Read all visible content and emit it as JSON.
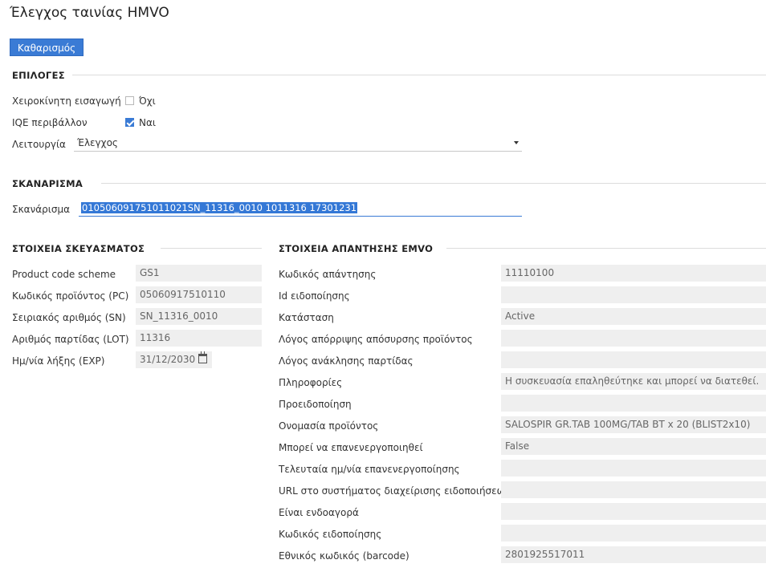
{
  "page": {
    "title": "Έλεγχος ταινίας ΗΜVO"
  },
  "toolbar": {
    "clear_label": "Καθαρισμός"
  },
  "options": {
    "heading": "ΕΠΙΛΟΓΕΣ",
    "manual_entry": {
      "label": "Χειροκίνητη εισαγωγή",
      "checked": false,
      "value": "Όχι"
    },
    "iqe_env": {
      "label": "IQE περιβάλλον",
      "checked": true,
      "value": "Ναι"
    },
    "function": {
      "label": "Λειτουργία",
      "value": "Έλεγχος"
    }
  },
  "scan": {
    "heading": "ΣΚΑΝΑΡΙΣΜΑ",
    "label": "Σκανάρισμα",
    "value": "010506091751011021SN_11316_0010 1011316 17301231"
  },
  "package": {
    "heading": "ΣΤΟΙΧΕΙΑ ΣΚΕΥΑΣΜΑΤΟΣ",
    "fields": [
      {
        "label": "Product code scheme",
        "value": "GS1"
      },
      {
        "label": "Κωδικός προϊόντος (PC)",
        "value": "05060917510110"
      },
      {
        "label": "Σειριακός αριθμός (SN)",
        "value": "SN_11316_0010"
      },
      {
        "label": "Αριθμός παρτίδας (LOT)",
        "value": "11316"
      },
      {
        "label": "Ημ/νία λήξης (EXP)",
        "value": "31/12/2030"
      }
    ]
  },
  "response": {
    "heading": "ΣΤΟΙΧΕΙΑ ΑΠΑΝΤΗΣΗΣ ΕΜVO",
    "fields": [
      {
        "label": "Κωδικός απάντησης",
        "value": "11110100"
      },
      {
        "label": "Id ειδοποίησης",
        "value": ""
      },
      {
        "label": "Κατάσταση",
        "value": "Active"
      },
      {
        "label": "Λόγος απόρριψης απόσυρσης προϊόντος",
        "value": ""
      },
      {
        "label": "Λόγος ανάκλησης παρτίδας",
        "value": ""
      },
      {
        "label": "Πληροφορίες",
        "value": "Η συσκευασία επαληθεύτηκε και μπορεί να διατεθεί."
      },
      {
        "label": "Προειδοποίηση",
        "value": ""
      },
      {
        "label": "Ονομασία προϊόντος",
        "value": "SALOSPIR GR.TAB 100MG/TAB BT x 20 (BLIST2x10)"
      },
      {
        "label": "Μπορεί να επανενεργοποιηθεί",
        "value": "False"
      },
      {
        "label": "Τελευταία ημ/νία επανενεργοποίησης",
        "value": ""
      },
      {
        "label": "URL στο συστήματος διαχείρισης ειδοποιήσεων",
        "value": ""
      },
      {
        "label": "Είναι ενδοαγορά",
        "value": ""
      },
      {
        "label": "Κωδικός ειδοποίησης",
        "value": ""
      },
      {
        "label": "Εθνικός κωδικός (barcode)",
        "value": "2801925517011"
      }
    ]
  }
}
